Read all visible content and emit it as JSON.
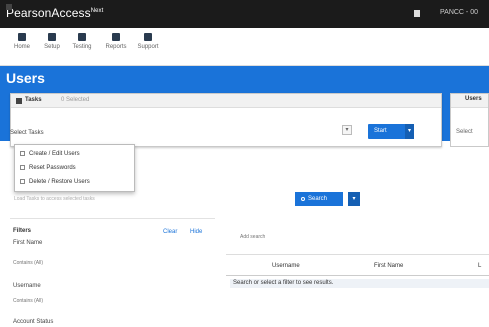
{
  "app": {
    "brand": "PearsonAccess",
    "brand_sup": "Next",
    "user_menu": "PANCC - 00"
  },
  "nav": {
    "items": [
      {
        "label": "Home",
        "icon": "home-icon"
      },
      {
        "label": "Setup",
        "icon": "setup-icon"
      },
      {
        "label": "Testing",
        "icon": "testing-icon"
      },
      {
        "label": "Reports",
        "icon": "reports-icon"
      },
      {
        "label": "Support",
        "icon": "support-icon"
      }
    ]
  },
  "page": {
    "title": "Users"
  },
  "tasks": {
    "label": "Tasks",
    "count": "0 Selected",
    "select_placeholder": "Select Tasks",
    "start_label": "Start",
    "options": [
      "Create / Edit Users",
      "Reset Passwords",
      "Delete / Restore Users"
    ],
    "helper": "Load Tasks to access selected tasks"
  },
  "right_panel": {
    "title": "Users",
    "text": "Select"
  },
  "search": {
    "button_label": "Search"
  },
  "filters": {
    "title": "Filters",
    "clear": "Clear",
    "hide": "Hide",
    "first_name_label": "First Name",
    "first_name_placeholder": "Contains (All)",
    "username_label": "Username",
    "username_placeholder": "Contains (All)",
    "account_status_label": "Account Status"
  },
  "results": {
    "search_placeholder": "Add search",
    "columns": [
      "Username",
      "First Name",
      "L"
    ],
    "empty_message": "Search or select a filter to see results."
  },
  "colors": {
    "brand_blue": "#1a73d9",
    "topbar": "#1b1b1b"
  }
}
